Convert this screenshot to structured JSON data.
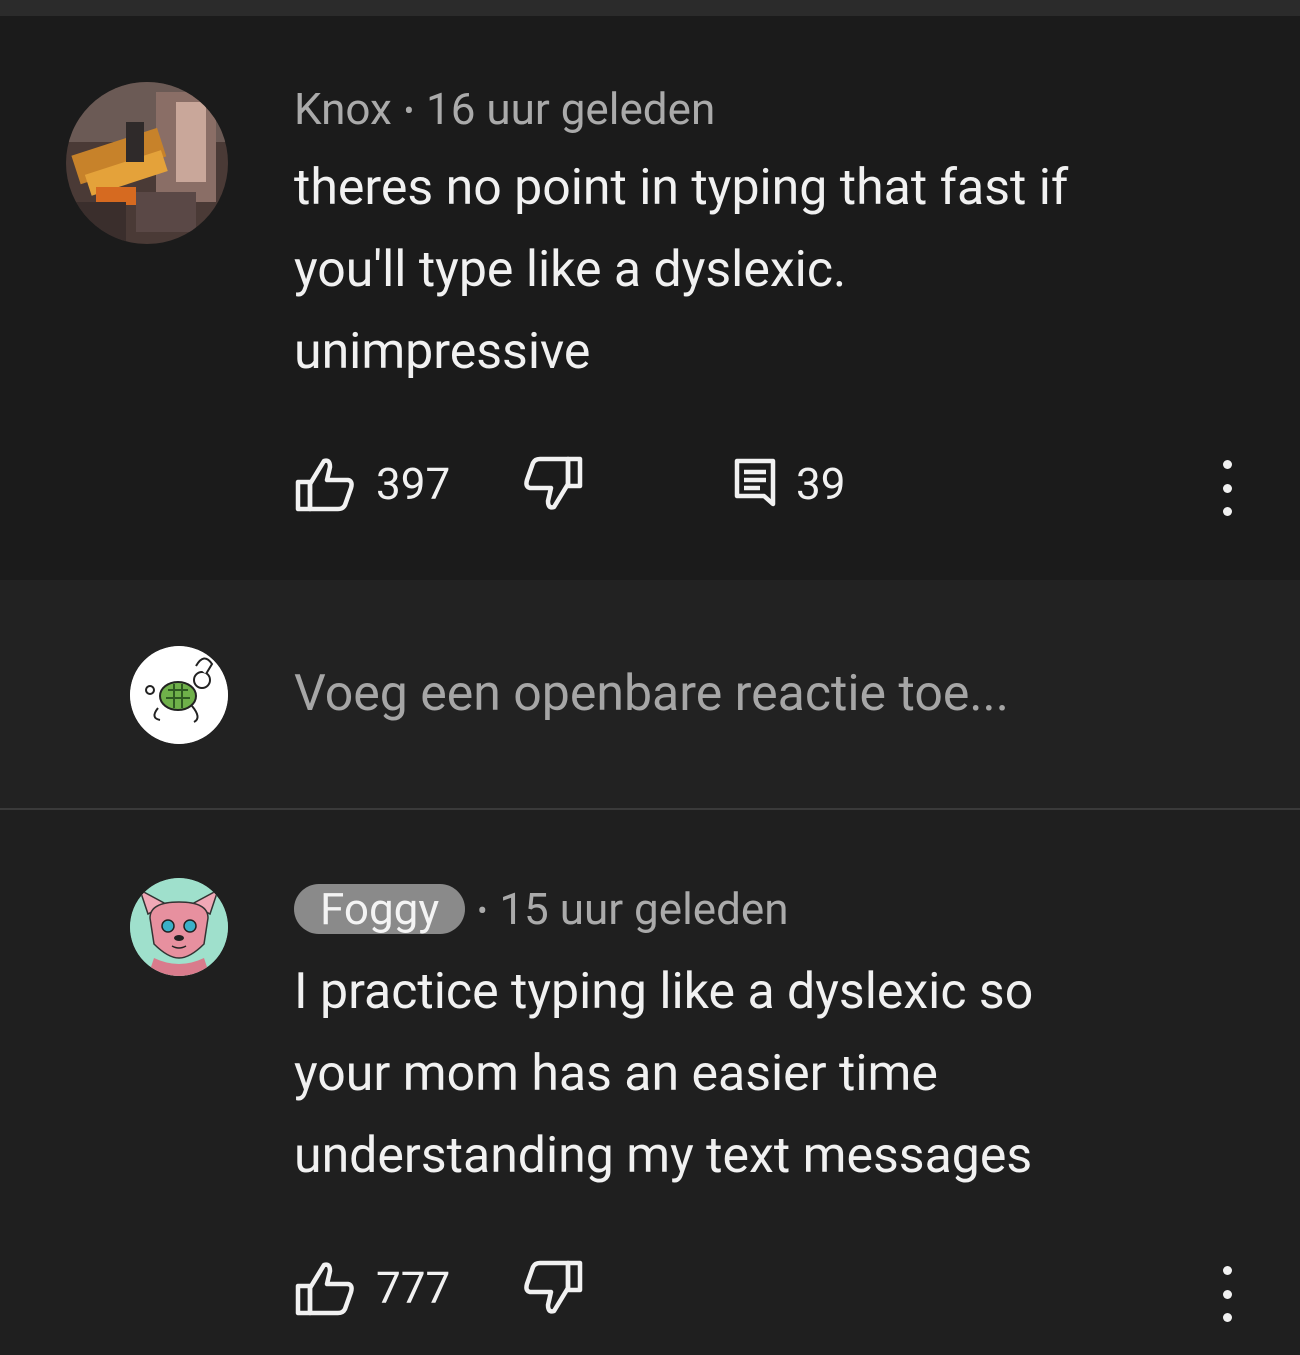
{
  "comments": [
    {
      "author": "Knox",
      "time": "16 uur geleden",
      "text": "theres no point in typing that fast if\nyou'll type like a dyslexic.\nunimpressive",
      "likes": "397",
      "replies": "39",
      "badge_author": false
    },
    {
      "author": "Foggy",
      "time": "15 uur geleden",
      "text": "I practice typing like a dyslexic so\nyour mom has an easier time\nunderstanding my text messages",
      "likes": "777",
      "badge_author": true
    }
  ],
  "composer": {
    "placeholder": "Voeg een openbare reactie toe..."
  },
  "separator": "•",
  "icons": {
    "like": "thumbs-up-icon",
    "dislike": "thumbs-down-icon",
    "reply": "reply-comment-icon",
    "menu": "more-vertical-icon"
  },
  "colors": {
    "background": "#212121",
    "text": "#f1f1f1",
    "secondary_text": "#aaaaaa",
    "badge_bg": "#8a8a8a"
  }
}
